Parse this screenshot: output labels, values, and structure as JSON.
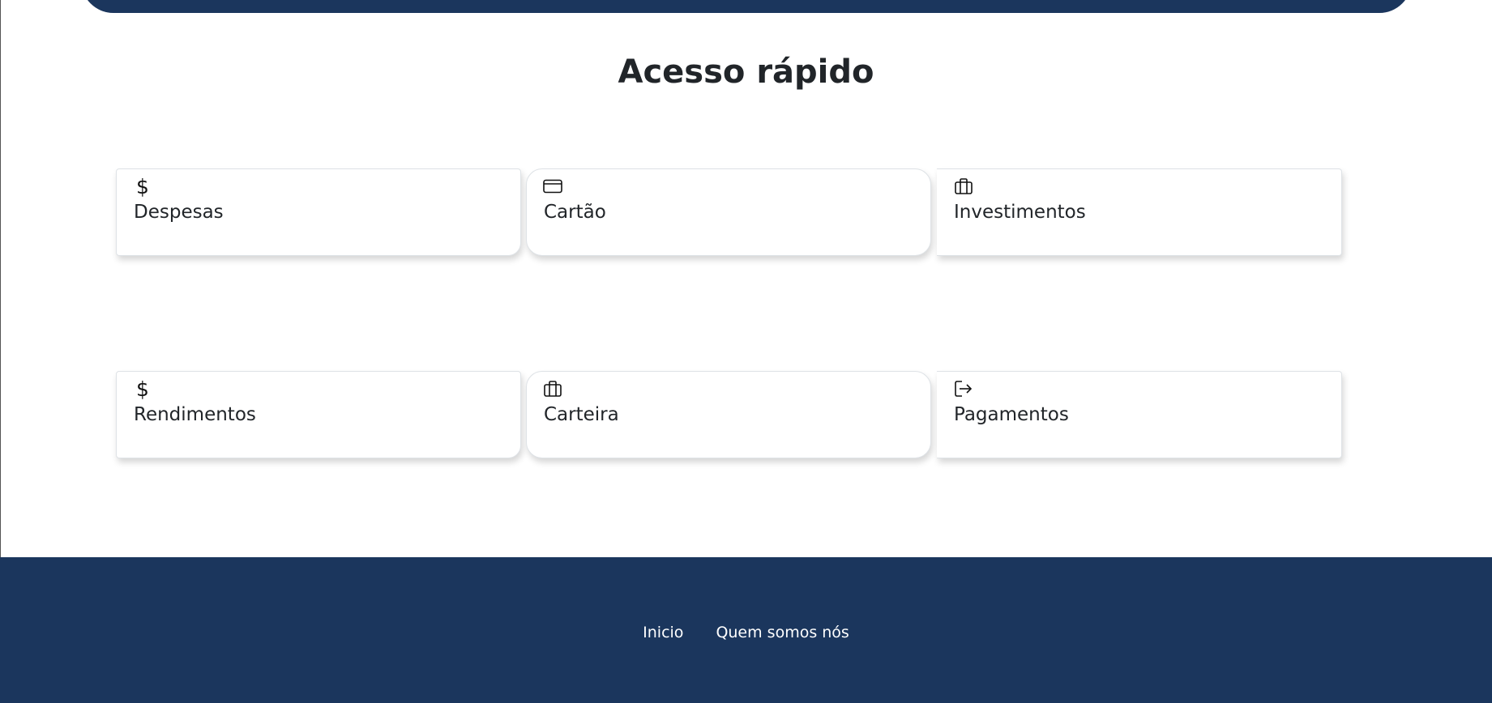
{
  "colors": {
    "navy": "#1b365d",
    "card_border": "#dee2e6",
    "text": "#212529"
  },
  "quick_access": {
    "title": "Acesso rápido",
    "cards": [
      {
        "label": "Despesas",
        "icon": "dollar-icon"
      },
      {
        "label": "Cartão",
        "icon": "credit-card-icon"
      },
      {
        "label": "Investimentos",
        "icon": "briefcase-icon"
      },
      {
        "label": "Rendimentos",
        "icon": "dollar-icon"
      },
      {
        "label": "Carteira",
        "icon": "briefcase-icon"
      },
      {
        "label": "Pagamentos",
        "icon": "box-arrow-right-icon"
      }
    ]
  },
  "footer": {
    "links": [
      "Inicio",
      "Quem somos nós"
    ]
  }
}
